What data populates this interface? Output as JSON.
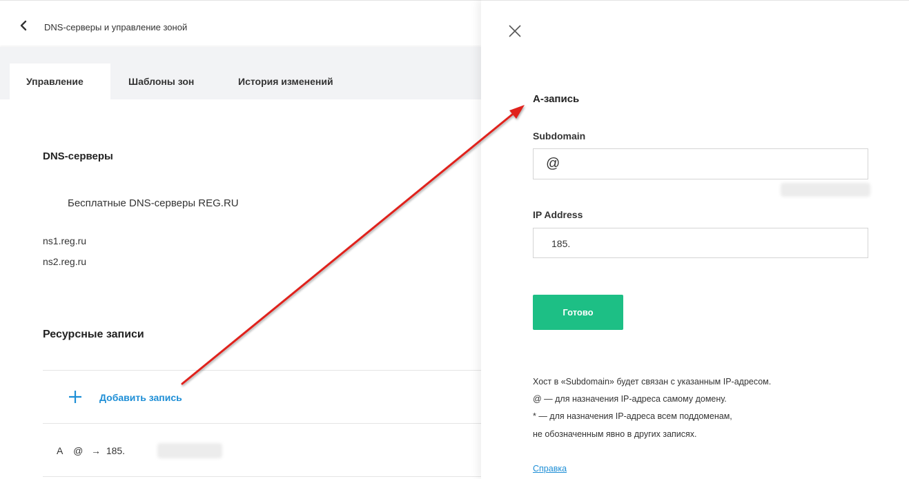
{
  "header": {
    "title": "DNS-серверы и управление зоной",
    "back_icon": "chevron-left-icon"
  },
  "tabs": [
    {
      "label": "Управление",
      "active": true
    },
    {
      "label": "Шаблоны зон",
      "active": false
    },
    {
      "label": "История изменений",
      "active": false
    }
  ],
  "dns_section": {
    "title": "DNS-серверы",
    "provider": "Бесплатные DNS-серверы REG.RU",
    "servers": [
      "ns1.reg.ru",
      "ns2.reg.ru"
    ]
  },
  "records_section": {
    "title": "Ресурсные записи",
    "add_label": "Добавить запись",
    "add_icon": "plus-icon",
    "records": [
      {
        "type": "A",
        "host": "@",
        "arrow": "→",
        "value": "185."
      }
    ]
  },
  "panel": {
    "close_icon": "close-icon",
    "title": "А-запись",
    "subdomain_label": "Subdomain",
    "subdomain_value": "@",
    "ip_label": "IP Address",
    "ip_value": "185.",
    "submit_label": "Готово",
    "help_lines": [
      "Хост в «Subdomain» будет связан с указанным IP-адресом.",
      "@ — для назначения IP-адреса самому домену.",
      "* — для назначения IP-адреса всем поддоменам,",
      "не обозначенным явно в других записях."
    ],
    "help_link": "Справка"
  },
  "colors": {
    "accent_green": "#1dbf85",
    "link_blue": "#1d8ed6",
    "tab_bar": "#f2f3f5",
    "annotation_arrow": "#e0201e"
  }
}
